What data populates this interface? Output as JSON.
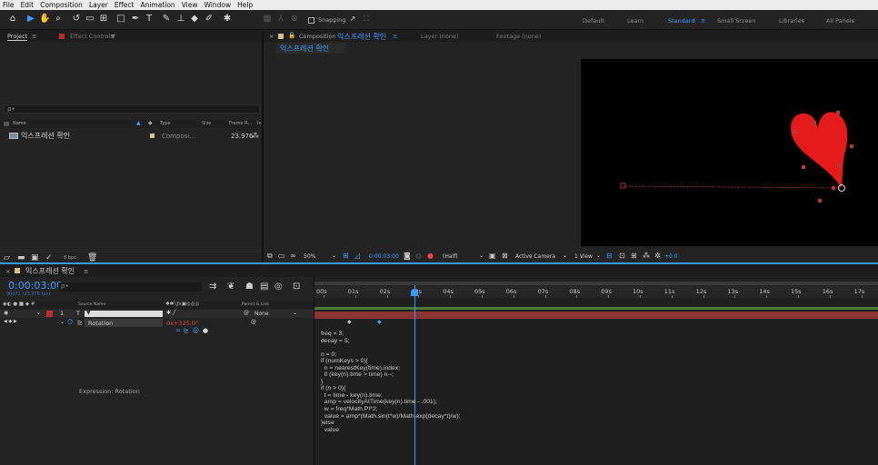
{
  "menu": [
    "File",
    "Edit",
    "Composition",
    "Layer",
    "Effect",
    "Animation",
    "View",
    "Window",
    "Help"
  ],
  "toolbar": {
    "snapping_label": "Snapping",
    "workspaces": [
      "Default",
      "Learn",
      "Standard",
      "Small Screen",
      "Libraries",
      "All Panels"
    ],
    "active_workspace_menu": "≡"
  },
  "project_panel": {
    "tab_project": "Project",
    "tab_menu": "≡",
    "tab_effect_controls": "Effect Controls",
    "tab_effect_controls_caret": "▼",
    "search_placeholder": "ρ•",
    "columns": [
      "Name",
      "Type",
      "Size",
      "Frame R...",
      "In"
    ],
    "items": [
      {
        "name": "익스프레션 확인",
        "type": "Composi...",
        "size": "",
        "frame_rate": "23.976"
      }
    ],
    "bpc": "8 bpc"
  },
  "comp_panel": {
    "tab_close": "×",
    "tab_prefix": "Composition",
    "comp_name": "익스프레션 확인",
    "tab_menu": "≡",
    "tab_layer": "Layer (none)",
    "tab_footage": "Footage (none)",
    "breadcrumb": "익스프레션 확인",
    "zoom": "50%",
    "timecode": "0:00:03:00",
    "resolution": "(Half)",
    "camera": "Active Camera",
    "view": "1 View",
    "exposure": "+0.0"
  },
  "timeline": {
    "tab_close": "×",
    "comp_name": "익스프레션 확인",
    "tab_menu": "≡",
    "timecode": "0:00:03:00",
    "frame_info": "00072 (23.976 fps)",
    "search_placeholder": "ρ•",
    "col_source": "Source Name",
    "col_parent": "Parent & Link",
    "layer_number": "1",
    "layer_type": "T",
    "layer_name": "▼",
    "parent_value": "None",
    "property_name": "Rotation",
    "property_value": "0x+325.0°",
    "expression_label": "Expression: Rotation",
    "ruler": [
      "00s",
      "01s",
      "02s",
      "03s",
      "04s",
      "05s",
      "06s",
      "07s",
      "08s",
      "09s",
      "10s",
      "11s",
      "12s",
      "13s",
      "14s",
      "15s",
      "16s",
      "17s"
    ],
    "current_time_fraction": 0.177
  },
  "expression": "freq = 3;\ndecay = 5;\n\nn = 0;\nif (numKeys > 0){\n  n = nearestKey(time).index;\n  if (key(n).time > time) n--;\n}\nif (n > 0){\n  t = time - key(n).time;\n  amp = velocityAtTime(key(n).time - .001);\n  w = freq*Math.PI*2;\n  value = amp*(Math.sin(t*w)/Math.exp(decay*t)/w);\n}else\n  value",
  "colors": {
    "accent": "#3c9bff",
    "heart": "#e51a1a",
    "label_red": "#c42a2a",
    "layer_bar": "#b33a3a",
    "work_area": "#4a7a3a"
  }
}
